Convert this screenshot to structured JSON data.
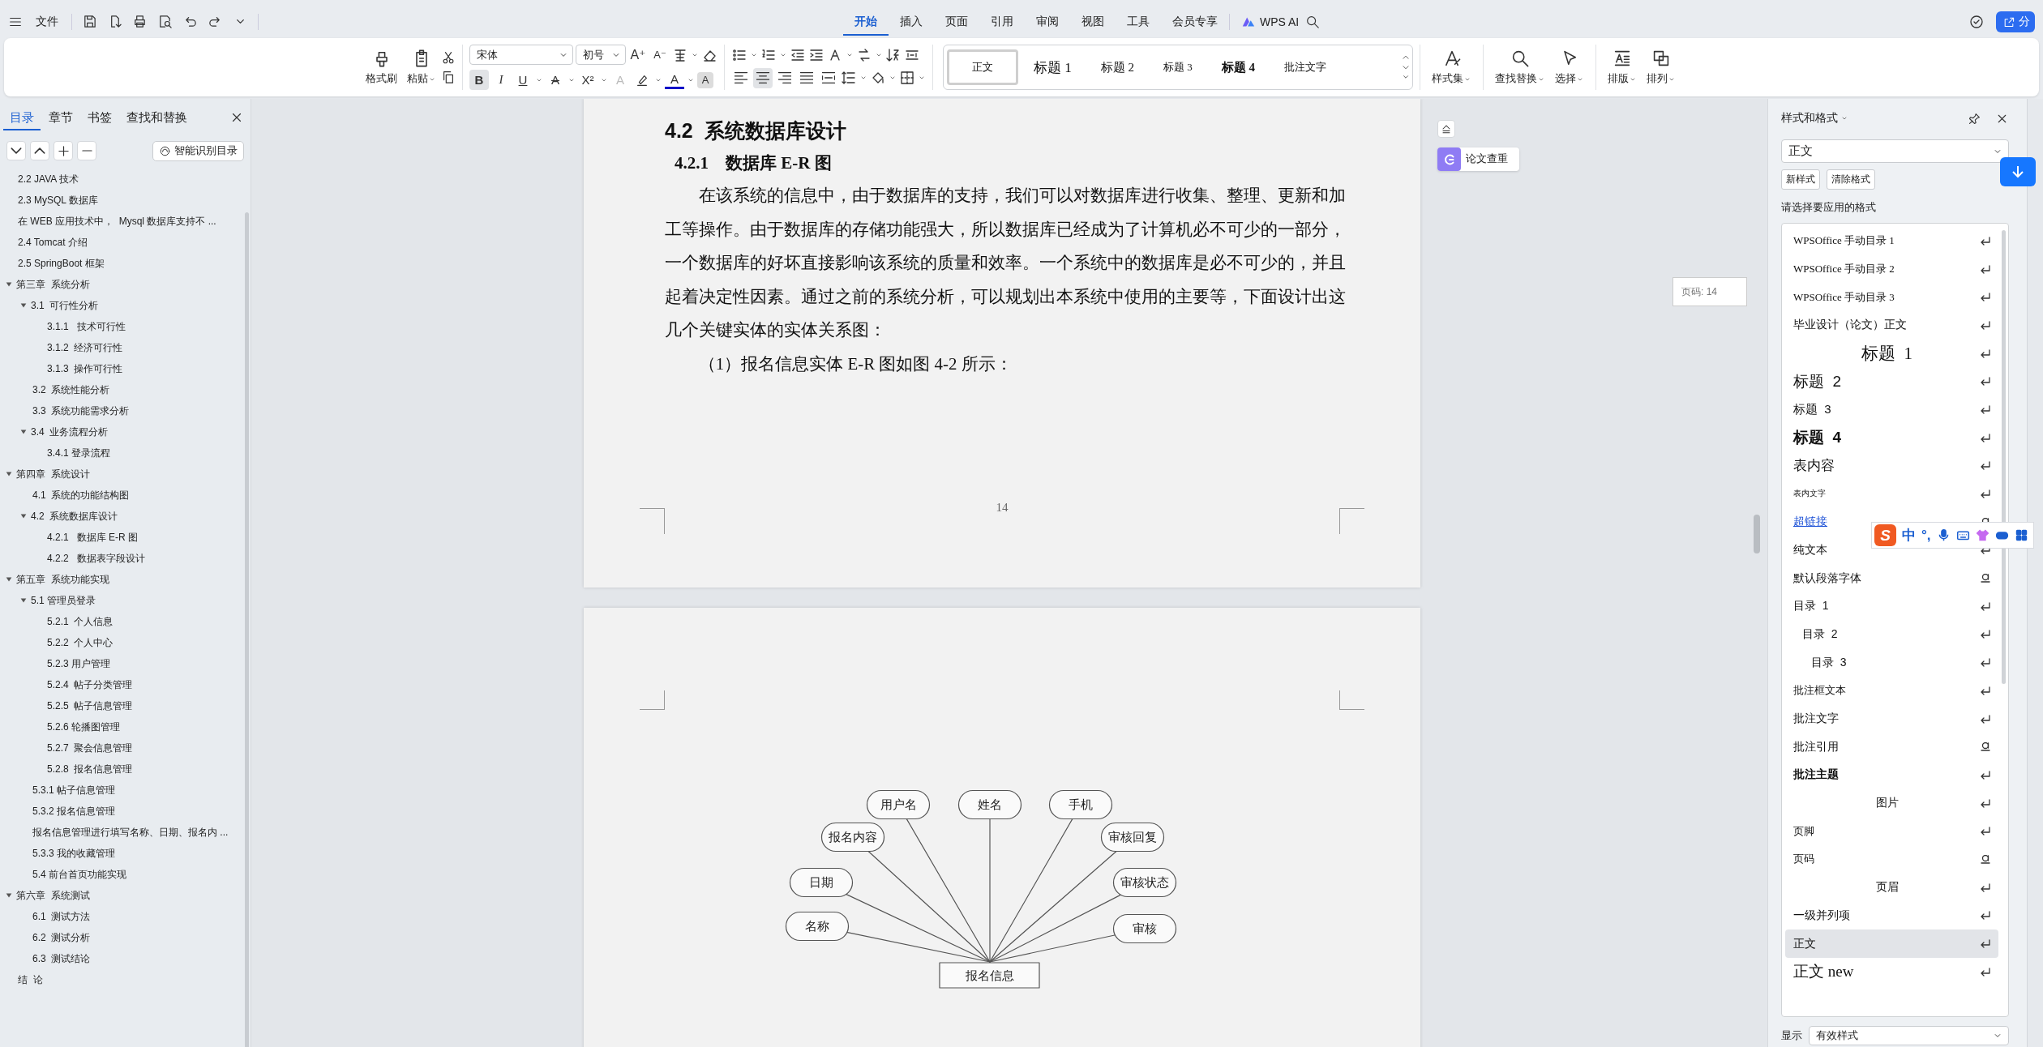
{
  "top_bar": {
    "file_menu": "文件",
    "menu_tabs": [
      {
        "label": "开始",
        "selected": true
      },
      {
        "label": "插入",
        "selected": false
      },
      {
        "label": "页面",
        "selected": false
      },
      {
        "label": "引用",
        "selected": false
      },
      {
        "label": "审阅",
        "selected": false
      },
      {
        "label": "视图",
        "selected": false
      },
      {
        "label": "工具",
        "selected": false
      },
      {
        "label": "会员专享",
        "selected": false
      }
    ],
    "ai_button": "WPS AI",
    "share_button": "分"
  },
  "ribbon": {
    "format_painter": "格式刷",
    "paste": "粘贴",
    "font_name": "宋体",
    "font_size": "初号",
    "size_tools": [
      {
        "kind": "grow",
        "glyph": "A⁺"
      },
      {
        "kind": "shrink",
        "glyph": "A⁻"
      }
    ],
    "format_toggles": [
      {
        "kind": "bold",
        "glyph": "B",
        "on": true
      },
      {
        "kind": "italic",
        "glyph": "I",
        "on": false
      },
      {
        "kind": "underline",
        "glyph": "U",
        "on": false
      },
      {
        "kind": "strike",
        "glyph": "A",
        "on": false
      },
      {
        "kind": "superscript",
        "glyph": "X²",
        "on": false
      }
    ],
    "color_tools": [
      {
        "kind": "effect",
        "glyph": "A"
      },
      {
        "kind": "highlight"
      },
      {
        "kind": "font-color",
        "glyph": "A"
      },
      {
        "kind": "shading",
        "glyph": "A"
      }
    ],
    "align_buttons": [
      {
        "kind": "left",
        "selected": false
      },
      {
        "kind": "center",
        "selected": true
      },
      {
        "kind": "right",
        "selected": false
      },
      {
        "kind": "justify",
        "selected": false
      },
      {
        "kind": "distributed",
        "selected": false
      }
    ],
    "style_gallery": [
      {
        "label": "正文",
        "kind": "normal",
        "selected": true
      },
      {
        "label": "标题 1",
        "kind": "h1",
        "selected": false
      },
      {
        "label": "标题 2",
        "kind": "h2",
        "selected": false
      },
      {
        "label": "标题 3",
        "kind": "h3",
        "selected": false
      },
      {
        "label": "标题 4",
        "kind": "h4",
        "selected": false
      },
      {
        "label": "批注文字",
        "kind": "normal",
        "selected": false
      }
    ],
    "style_set": "样式集",
    "find_replace": "查找替换",
    "select": "选择",
    "layout": "排版",
    "arrange": "排列"
  },
  "nav_panel": {
    "tabs": [
      {
        "label": "目录",
        "selected": true
      },
      {
        "label": "章节",
        "selected": false
      },
      {
        "label": "书签",
        "selected": false
      },
      {
        "label": "查找和替换",
        "selected": false
      }
    ],
    "smart_toc_button": "智能识别目录",
    "toc": [
      {
        "label": "2.2 JAVA 技术"
      },
      {
        "label": "2.3 MySQL 数据库"
      },
      {
        "label": "在 WEB 应用技术中，  Mysql 数据库支持不 ..."
      },
      {
        "label": "2.4 Tomcat 介绍"
      },
      {
        "label": "2.5 SpringBoot 框架"
      },
      {
        "label": "第三章  系统分析",
        "expanded": true,
        "children": [
          {
            "label": "3.1  可行性分析",
            "expanded": true,
            "children": [
              {
                "label": "3.1.1   技术可行性"
              },
              {
                "label": "3.1.2  经济可行性"
              },
              {
                "label": "3.1.3  操作可行性"
              }
            ]
          },
          {
            "label": "3.2  系统性能分析"
          },
          {
            "label": "3.3  系统功能需求分析"
          },
          {
            "label": "3.4  业务流程分析",
            "expanded": true,
            "children": [
              {
                "label": "3.4.1 登录流程"
              }
            ]
          }
        ]
      },
      {
        "label": "第四章  系统设计",
        "expanded": true,
        "children": [
          {
            "label": "4.1  系统的功能结构图"
          },
          {
            "label": "4.2  系统数据库设计",
            "expanded": true,
            "children": [
              {
                "label": "4.2.1   数据库 E-R 图"
              },
              {
                "label": "4.2.2   数据表字段设计"
              }
            ]
          }
        ]
      },
      {
        "label": "第五章  系统功能实现",
        "expanded": true,
        "children": [
          {
            "label": "5.1 管理员登录",
            "expanded": true,
            "children": [
              {
                "label": "5.2.1  个人信息"
              },
              {
                "label": "5.2.2  个人中心"
              },
              {
                "label": "5.2.3 用户管理"
              },
              {
                "label": "5.2.4  帖子分类管理"
              },
              {
                "label": "5.2.5  帖子信息管理"
              },
              {
                "label": "5.2.6 轮播图管理"
              },
              {
                "label": "5.2.7  聚会信息管理"
              },
              {
                "label": "5.2.8  报名信息管理"
              }
            ]
          },
          {
            "label": "5.3.1 帖子信息管理"
          },
          {
            "label": "5.3.2 报名信息管理"
          },
          {
            "label": "报名信息管理进行填写名称、日期、报名内 ..."
          },
          {
            "label": "5.3.3 我的收藏管理"
          },
          {
            "label": "5.4 前台首页功能实现"
          }
        ]
      },
      {
        "label": "第六章  系统测试",
        "expanded": true,
        "children": [
          {
            "label": "6.1  测试方法"
          },
          {
            "label": "6.2  测试分析"
          },
          {
            "label": "6.3  测试结论"
          }
        ]
      },
      {
        "label": "结  论"
      }
    ]
  },
  "document": {
    "pages": [
      {
        "blocks": [
          {
            "kind": "heading2",
            "text": "4.2  系统数据库设计"
          },
          {
            "kind": "heading3",
            "text": "4.2.1    数据库 E-R 图"
          },
          {
            "kind": "paragraph",
            "text": "在该系统的信息中，由于数据库的支持，我们可以对数据库进行收集、整理、更新和加工等操作。由于数据库的存储功能强大，所以数据库已经成为了计算机必不可少的一部分，一个数据库的好坏直接影响该系统的质量和效率。一个系统中的数据库是必不可少的，并且起着决定性因素。通过之前的系统分析，可以规划出本系统中使用的主要等，下面设计出这几个关键实体的实体关系图："
          },
          {
            "kind": "paragraph",
            "text": "（1）报名信息实体 E-R 图如图 4-2 所示："
          }
        ],
        "page_number": "14"
      },
      {
        "er_diagram": {
          "entity": "报名信息",
          "attributes": [
            "用户名",
            "姓名",
            "手机",
            "报名内容",
            "审核回复",
            "日期",
            "审核状态",
            "名称",
            "审核"
          ]
        }
      }
    ],
    "check_button": "论文查重",
    "page_indicator": "页码: 14"
  },
  "styles_panel": {
    "title": "样式和格式",
    "current_style": "正文",
    "buttons": [
      "新样式",
      "清除格式"
    ],
    "prompt": "请选择要应用的格式",
    "styles": [
      {
        "label": "WPSOffice 手动目录 1",
        "kind": "serif",
        "character": false,
        "selected": false
      },
      {
        "label": "WPSOffice 手动目录 2",
        "kind": "serif",
        "character": false,
        "selected": false
      },
      {
        "label": "WPSOffice 手动目录 3",
        "kind": "serif",
        "character": false,
        "selected": false
      },
      {
        "label": "毕业设计（论文）正文",
        "kind": "plain",
        "character": false,
        "selected": false
      },
      {
        "label": "标题  1",
        "kind": "title",
        "character": false,
        "selected": false
      },
      {
        "label": "标题  2",
        "kind": "h2",
        "character": false,
        "selected": false
      },
      {
        "label": "标题  3",
        "kind": "h3",
        "character": false,
        "selected": false
      },
      {
        "label": "标题  4",
        "kind": "h4",
        "character": false,
        "selected": false
      },
      {
        "label": "表内容",
        "kind": "large",
        "character": false,
        "selected": false
      },
      {
        "label": "表内文字",
        "kind": "tiny",
        "character": false,
        "selected": false
      },
      {
        "label": "超链接",
        "kind": "link",
        "character": true,
        "selected": false
      },
      {
        "label": "纯文本",
        "kind": "plain",
        "character": false,
        "selected": false
      },
      {
        "label": "默认段落字体",
        "kind": "plain",
        "character": true,
        "selected": false
      },
      {
        "label": "目录  1",
        "kind": "toc1",
        "character": false,
        "selected": false
      },
      {
        "label": "目录  2",
        "kind": "toc2",
        "character": false,
        "selected": false
      },
      {
        "label": "目录  3",
        "kind": "toc3",
        "character": false,
        "selected": false
      },
      {
        "label": "批注框文本",
        "kind": "small",
        "character": false,
        "selected": false
      },
      {
        "label": "批注文字",
        "kind": "plain",
        "character": false,
        "selected": false
      },
      {
        "label": "批注引用",
        "kind": "plain",
        "character": true,
        "selected": false
      },
      {
        "label": "批注主题",
        "kind": "bold",
        "character": false,
        "selected": false
      },
      {
        "label": "图片",
        "kind": "center",
        "character": false,
        "selected": false
      },
      {
        "label": "页脚",
        "kind": "small",
        "character": false,
        "selected": false
      },
      {
        "label": "页码",
        "kind": "small",
        "character": true,
        "selected": false
      },
      {
        "label": "页眉",
        "kind": "center",
        "character": false,
        "selected": false
      },
      {
        "label": "一级并列项",
        "kind": "plain",
        "character": false,
        "selected": false
      },
      {
        "label": "正文",
        "kind": "plain",
        "character": false,
        "selected": true
      },
      {
        "label": "正文 new",
        "kind": "serif-large",
        "character": false,
        "selected": false
      }
    ],
    "show_label": "显示",
    "show_value": "有效样式"
  },
  "ime_toolbar": {
    "logo": "S",
    "mode": "中",
    "punctuation": "°,"
  }
}
